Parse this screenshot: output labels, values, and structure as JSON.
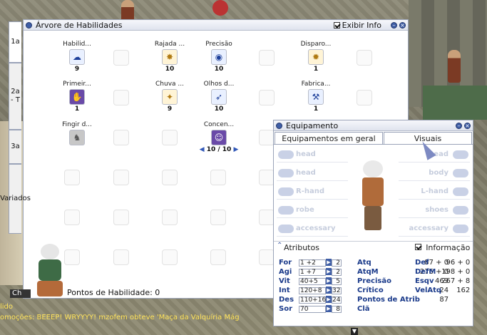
{
  "skill_tree": {
    "title": "Árvore de Habilidades",
    "exibir_info_label": "Exibir Info",
    "exibir_info_checked": true,
    "tabs": [
      "1a",
      "2a - T",
      "3a",
      "Variados"
    ],
    "skills": [
      {
        "name": "Habilid...",
        "level": "9",
        "icon": "skill-cloud-icon"
      },
      {
        "name": "Rajada ...",
        "level": "10",
        "icon": "skill-burst-icon"
      },
      {
        "name": "Precisão",
        "level": "10",
        "icon": "skill-eye-icon"
      },
      {
        "name": "Disparo...",
        "level": "1",
        "icon": "skill-shot-icon"
      },
      {
        "name": "Primeir...",
        "level": "1",
        "icon": "skill-hand-icon"
      },
      {
        "name": "Chuva ...",
        "level": "9",
        "icon": "skill-rain-icon"
      },
      {
        "name": "Olhos d...",
        "level": "10",
        "icon": "skill-eyes-icon"
      },
      {
        "name": "Fabrica...",
        "level": "1",
        "icon": "skill-craft-icon"
      },
      {
        "name": "Fingir d...",
        "level": "",
        "icon": "skill-fake-icon"
      },
      {
        "name": "Concen...",
        "level": "10 / 10",
        "icon": "skill-concentration-icon"
      }
    ],
    "skill_points_label": "Pontos de Habilidade: 0"
  },
  "equipment": {
    "title": "Equipamento",
    "tabs": [
      "Equipamentos em geral",
      "Visuais"
    ],
    "left_slots": [
      "head",
      "head",
      "R-hand",
      "robe",
      "accessary"
    ],
    "right_slots": [
      "head",
      "body",
      "L-hand",
      "shoes",
      "accessary"
    ],
    "attr_title": "Atributos",
    "info_label": "Informação",
    "info_checked": true,
    "stats": [
      {
        "name": "For",
        "value": "1 +2",
        "cost": "2"
      },
      {
        "name": "Agi",
        "value": "1 +7",
        "cost": "2"
      },
      {
        "name": "Vit",
        "value": "40+5",
        "cost": "5"
      },
      {
        "name": "Int",
        "value": "120+8",
        "cost": "32"
      },
      {
        "name": "Des",
        "value": "110+16",
        "cost": "24"
      },
      {
        "name": "Sor",
        "value": "70",
        "cost": "8"
      }
    ],
    "derived_mid": [
      {
        "name": "Atq",
        "value": "87 + 0"
      },
      {
        "name": "AtqM",
        "value": "276 + 0"
      },
      {
        "name": "Precisão",
        "value": "469"
      },
      {
        "name": "Crítico",
        "value": "24"
      },
      {
        "name": "Pontos de Atrib",
        "value": "87"
      },
      {
        "name": "Clã",
        "value": ""
      }
    ],
    "derived_right": [
      {
        "name": "Def",
        "value": "96 + 0"
      },
      {
        "name": "DefM",
        "value": "198 + 0"
      },
      {
        "name": "Esqv",
        "value": "267 + 8"
      },
      {
        "name": "VelAtq",
        "value": "162"
      }
    ]
  },
  "chat": {
    "line1": "lido",
    "line2": "omoções:  BEEEP! WRYYYY! mzofem obteve 'Maça da Valquíria Mág",
    "button": "Ch"
  },
  "colors": {
    "accent": "#3f5ea6",
    "chat_yellow": "#ffe35a"
  }
}
